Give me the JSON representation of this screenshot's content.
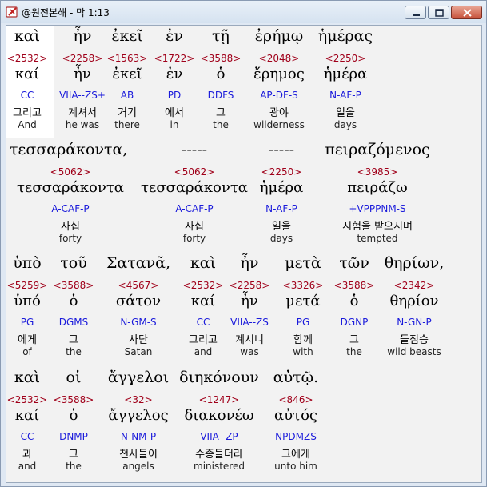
{
  "window": {
    "title": "@원전본해 - 막 1:13",
    "icon": "cross-book-icon",
    "controls": [
      "minimize-icon",
      "maximize-icon",
      "close-icon"
    ]
  },
  "rows": [
    {
      "words": [
        {
          "greek": "καὶ",
          "strong": "<2532>",
          "lemma": "καί",
          "parse": "CC",
          "korean": "그리고",
          "english": "And"
        },
        {
          "greek": "ἦν",
          "strong": "<2258>",
          "lemma": "ἦν",
          "parse": "VIIA--ZS+",
          "korean": "계셔서",
          "english": "he was"
        },
        {
          "greek": "ἐκεῖ",
          "strong": "<1563>",
          "lemma": "ἐκεῖ",
          "parse": "AB",
          "korean": "거기",
          "english": "there"
        },
        {
          "greek": "ἐν",
          "strong": "<1722>",
          "lemma": "ἐν",
          "parse": "PD",
          "korean": "에서",
          "english": "in"
        },
        {
          "greek": "τῇ",
          "strong": "<3588>",
          "lemma": "ὁ",
          "parse": "DDFS",
          "korean": "그",
          "english": "the"
        },
        {
          "greek": "ἐρήμῳ",
          "strong": "<2048>",
          "lemma": "ἔρημος",
          "parse": "AP-DF-S",
          "korean": "광야",
          "english": "wilderness"
        },
        {
          "greek": "ἡμέρας",
          "strong": "<2250>",
          "lemma": "ἡμέρα",
          "parse": "N-AF-P",
          "korean": "일을",
          "english": "days"
        }
      ]
    },
    {
      "words": [
        {
          "greek": "τεσσαράκοντα,",
          "strong": "<5062>",
          "lemma": "τεσσαράκοντα",
          "parse": "A-CAF-P",
          "korean": "사십",
          "english": "forty"
        },
        {
          "greek": "-----",
          "strong": "<5062>",
          "lemma": "τεσσαράκοντα",
          "parse": "A-CAF-P",
          "korean": "사십",
          "english": "forty"
        },
        {
          "greek": "-----",
          "strong": "<2250>",
          "lemma": "ἡμέρα",
          "parse": "N-AF-P",
          "korean": "일을",
          "english": "days"
        },
        {
          "greek": "πειραζόμενος",
          "strong": "<3985>",
          "lemma": "πειράζω",
          "parse": "+VPPPNM-S",
          "korean": "시험을 받으시며",
          "english": "tempted"
        }
      ]
    },
    {
      "words": [
        {
          "greek": "ὑπὸ",
          "strong": "<5259>",
          "lemma": "ὑπό",
          "parse": "PG",
          "korean": "에게",
          "english": "of"
        },
        {
          "greek": "τοῦ",
          "strong": "<3588>",
          "lemma": "ὁ",
          "parse": "DGMS",
          "korean": "그",
          "english": "the"
        },
        {
          "greek": "Σατανᾶ,",
          "strong": "<4567>",
          "lemma": "σάτον",
          "parse": "N-GM-S",
          "korean": "사단",
          "english": "Satan"
        },
        {
          "greek": "καὶ",
          "strong": "<2532>",
          "lemma": "καί",
          "parse": "CC",
          "korean": "그리고",
          "english": "and"
        },
        {
          "greek": "ἦν",
          "strong": "<2258>",
          "lemma": "ἦν",
          "parse": "VIIA--ZS",
          "korean": "계시니",
          "english": "was"
        },
        {
          "greek": "μετὰ",
          "strong": "<3326>",
          "lemma": "μετά",
          "parse": "PG",
          "korean": "함께",
          "english": "with"
        },
        {
          "greek": "τῶν",
          "strong": "<3588>",
          "lemma": "ὁ",
          "parse": "DGNP",
          "korean": "그",
          "english": "the"
        },
        {
          "greek": "θηρίων,",
          "strong": "<2342>",
          "lemma": "θηρίον",
          "parse": "N-GN-P",
          "korean": "들짐승",
          "english": "wild beasts"
        }
      ]
    },
    {
      "words": [
        {
          "greek": "καὶ",
          "strong": "<2532>",
          "lemma": "καί",
          "parse": "CC",
          "korean": "과",
          "english": "and"
        },
        {
          "greek": "οἱ",
          "strong": "<3588>",
          "lemma": "ὁ",
          "parse": "DNMP",
          "korean": "그",
          "english": "the"
        },
        {
          "greek": "ἄγγελοι",
          "strong": "<32>",
          "lemma": "ἄγγελος",
          "parse": "N-NM-P",
          "korean": "천사들이",
          "english": "angels"
        },
        {
          "greek": "διηκόνουν",
          "strong": "<1247>",
          "lemma": "διακονέω",
          "parse": "VIIA--ZP",
          "korean": "수종들더라",
          "english": "ministered"
        },
        {
          "greek": "αὐτῷ.",
          "strong": "<846>",
          "lemma": "αὐτός",
          "parse": "NPDMZS",
          "korean": "그에게",
          "english": "unto him"
        }
      ]
    }
  ],
  "colors": {
    "strong": "#a0001a",
    "parse": "#1a1adb",
    "highlight": "#ffffff",
    "background": "#f2f2f2"
  }
}
